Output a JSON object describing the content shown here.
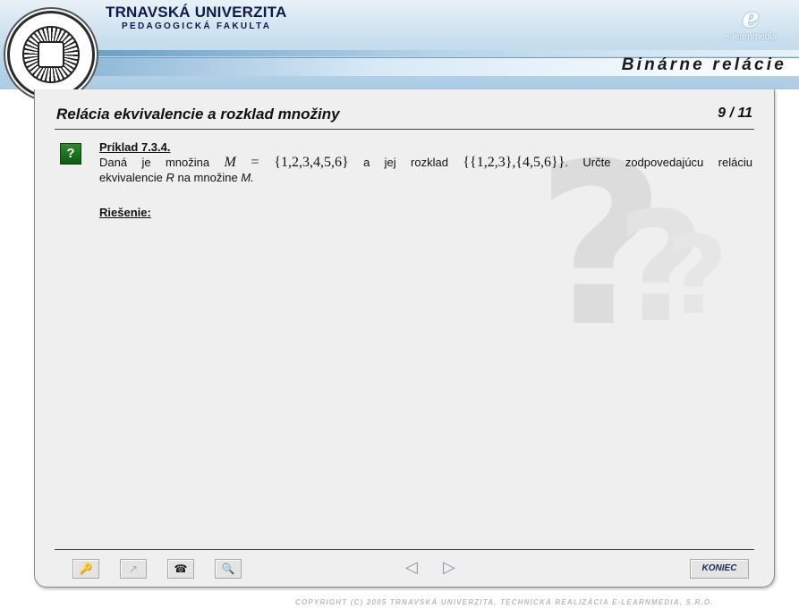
{
  "header": {
    "university": "TRNAVSKÁ UNIVERZITA",
    "faculty": "PEDAGOGICKÁ FAKULTA",
    "brand_letter": "e",
    "brand_name": "e-learnmedia",
    "course_title": "Binárne relácie"
  },
  "slide": {
    "title": "Relácia ekvivalencie a rozklad množiny",
    "page": "9 / 11",
    "example_icon": "?",
    "example_title": "Príklad 7.3.4.",
    "text_1": "Daná je množina",
    "set_symbol": "M",
    "set_eq": " = {1,2,3,4,5,6}",
    "text_2": "a jej rozklad",
    "partition": "{{1,2,3},{4,5,6}}",
    "text_3": ". Určte zodpovedajúcu reláciu",
    "text_4": "ekvivalencie",
    "relation_symbol": "R",
    "text_5": "na množine",
    "text_6": "M.",
    "solution_label": "Riešenie:"
  },
  "toolbar": {
    "key_icon": "🔑",
    "external_icon": "↗",
    "phone_icon": "☎",
    "search_icon": "🔍",
    "prev_icon": "◁",
    "next_icon": "▷",
    "end_label": "KONIEC"
  },
  "footer": {
    "copyright": "COPYRIGHT (C) 2005 TRNAVSKÁ UNIVERZITA, TECHNICKÁ REALIZÁCIA E-LEARNMEDIA, S.R.O."
  }
}
